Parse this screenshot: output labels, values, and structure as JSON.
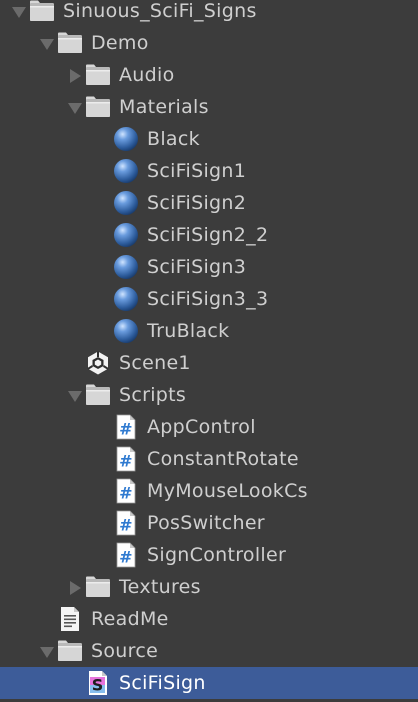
{
  "project_tree": {
    "items": [
      {
        "label": "Sinuous_SciFi_Signs",
        "icon": "folder-icon",
        "depth": 0,
        "arrow": "expanded"
      },
      {
        "label": "Demo",
        "icon": "folder-icon",
        "depth": 1,
        "arrow": "expanded"
      },
      {
        "label": "Audio",
        "icon": "folder-icon",
        "depth": 2,
        "arrow": "collapsed"
      },
      {
        "label": "Materials",
        "icon": "folder-icon",
        "depth": 2,
        "arrow": "expanded"
      },
      {
        "label": "Black",
        "icon": "material-icon",
        "depth": 3,
        "arrow": "none"
      },
      {
        "label": "SciFiSign1",
        "icon": "material-icon",
        "depth": 3,
        "arrow": "none"
      },
      {
        "label": "SciFiSign2",
        "icon": "material-icon",
        "depth": 3,
        "arrow": "none"
      },
      {
        "label": "SciFiSign2_2",
        "icon": "material-icon",
        "depth": 3,
        "arrow": "none"
      },
      {
        "label": "SciFiSign3",
        "icon": "material-icon",
        "depth": 3,
        "arrow": "none"
      },
      {
        "label": "SciFiSign3_3",
        "icon": "material-icon",
        "depth": 3,
        "arrow": "none"
      },
      {
        "label": "TruBlack",
        "icon": "material-icon",
        "depth": 3,
        "arrow": "none"
      },
      {
        "label": "Scene1",
        "icon": "unity-scene-icon",
        "depth": 2,
        "arrow": "none"
      },
      {
        "label": "Scripts",
        "icon": "folder-icon",
        "depth": 2,
        "arrow": "expanded"
      },
      {
        "label": "AppControl",
        "icon": "csharp-script-icon",
        "depth": 3,
        "arrow": "none"
      },
      {
        "label": "ConstantRotate",
        "icon": "csharp-script-icon",
        "depth": 3,
        "arrow": "none"
      },
      {
        "label": "MyMouseLookCs",
        "icon": "csharp-script-icon",
        "depth": 3,
        "arrow": "none"
      },
      {
        "label": "PosSwitcher",
        "icon": "csharp-script-icon",
        "depth": 3,
        "arrow": "none"
      },
      {
        "label": "SignController",
        "icon": "csharp-script-icon",
        "depth": 3,
        "arrow": "none"
      },
      {
        "label": "Textures",
        "icon": "folder-icon",
        "depth": 2,
        "arrow": "collapsed"
      },
      {
        "label": "ReadMe",
        "icon": "text-document-icon",
        "depth": 1,
        "arrow": "none"
      },
      {
        "label": "Source",
        "icon": "folder-icon",
        "depth": 1,
        "arrow": "expanded"
      },
      {
        "label": "SciFiSign",
        "icon": "shader-icon",
        "depth": 2,
        "arrow": "none",
        "selected": true
      }
    ]
  },
  "colors": {
    "background": "#3c3c3c",
    "text": "#cfcfcf",
    "selection": "#3d5c99"
  }
}
